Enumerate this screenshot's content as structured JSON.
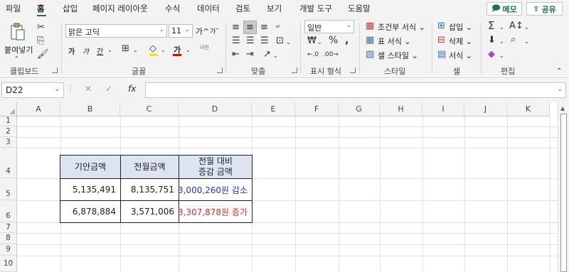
{
  "menu": {
    "tabs": [
      "파일",
      "홈",
      "삽입",
      "페이지 레이아웃",
      "수식",
      "데이터",
      "검토",
      "보기",
      "개발 도구",
      "도움말"
    ],
    "active_tab": "홈",
    "memo_label": "메모",
    "share_label": "공유"
  },
  "ribbon": {
    "clipboard": {
      "label": "클립보드",
      "paste": "붙여넣기"
    },
    "font": {
      "label": "글꼴",
      "name": "맑은 고딕",
      "size": "11",
      "grow": "가",
      "shrink": "가",
      "bold": "가",
      "italic": "가",
      "underline": "간",
      "color_letter": "가",
      "phonetic": "내천"
    },
    "alignment": {
      "label": "맞춤"
    },
    "number": {
      "label": "표시 형식",
      "format": "일반"
    },
    "styles": {
      "label": "스타일",
      "conditional": "조건부 서식",
      "table": "표 서식",
      "cell_styles": "셀 스타일"
    },
    "cells": {
      "label": "셀",
      "insert": "삽입",
      "delete": "삭제",
      "format": "서식"
    },
    "editing": {
      "label": "편집"
    }
  },
  "formula_bar": {
    "name_box": "D22",
    "fx": "fx",
    "formula": ""
  },
  "columns": [
    "A",
    "B",
    "C",
    "D",
    "E",
    "F",
    "G",
    "H",
    "I",
    "J",
    "K"
  ],
  "rows": [
    "1",
    "2",
    "3",
    "4",
    "5",
    "6",
    "7",
    "8",
    "9",
    "10"
  ],
  "table": {
    "headers": [
      "기안금액",
      "전월금액",
      "전월 대비\n증감 금액"
    ],
    "rows": [
      {
        "b": "5,135,491",
        "c": "8,135,751",
        "d": "3,000,260원 감소"
      },
      {
        "b": "6,878,884",
        "c": "3,571,006",
        "d": "3,307,878원 증가"
      }
    ]
  },
  "colors": {
    "accent": "#217346",
    "header_fill": "#dde4f1",
    "decrease": "#2233dd",
    "increase": "#e0282d"
  }
}
